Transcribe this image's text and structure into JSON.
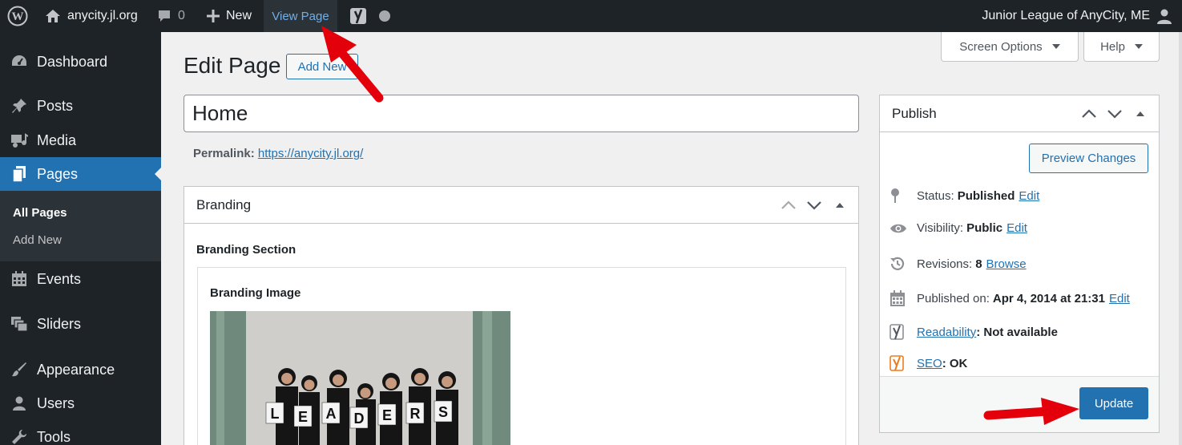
{
  "adminbar": {
    "site_name": "anycity.jl.org",
    "comments_count": "0",
    "new_label": "New",
    "view_page_label": "View Page",
    "account_name": "Junior League of AnyCity, ME"
  },
  "sidebar": {
    "items": [
      {
        "label": "Dashboard",
        "icon": "dashboard-icon"
      },
      {
        "label": "Posts",
        "icon": "pin-icon"
      },
      {
        "label": "Media",
        "icon": "media-icon"
      },
      {
        "label": "Pages",
        "icon": "pages-icon"
      },
      {
        "label": "Events",
        "icon": "calendar-icon"
      },
      {
        "label": "Sliders",
        "icon": "sliders-icon"
      },
      {
        "label": "Appearance",
        "icon": "brush-icon"
      },
      {
        "label": "Users",
        "icon": "users-icon"
      },
      {
        "label": "Tools",
        "icon": "wrench-icon"
      }
    ],
    "submenu": [
      "All Pages",
      "Add New"
    ]
  },
  "header": {
    "title": "Edit Page",
    "add_new_label": "Add New",
    "screen_options_label": "Screen Options",
    "help_label": "Help"
  },
  "editor": {
    "title_value": "Home",
    "permalink_label": "Permalink:",
    "permalink_url": "https://anycity.jl.org/"
  },
  "branding": {
    "box_title": "Branding",
    "section_label": "Branding Section",
    "image_label": "Branding Image",
    "photo_letters": [
      "L",
      "E",
      "A",
      "D",
      "E",
      "R",
      "S"
    ]
  },
  "publish": {
    "title": "Publish",
    "preview_label": "Preview Changes",
    "status_label": "Status:",
    "status_value": "Published",
    "visibility_label": "Visibility:",
    "visibility_value": "Public",
    "revisions_label": "Revisions:",
    "revisions_value": "8",
    "browse_label": "Browse",
    "published_label": "Published on:",
    "published_value": "Apr 4, 2014 at 21:31",
    "edit_label": "Edit",
    "readability_label": "Readability",
    "readability_value": ": Not available",
    "seo_label": "SEO",
    "seo_value": ": OK",
    "update_label": "Update"
  },
  "colors": {
    "admin_dark": "#1d2327",
    "accent": "#2271b1",
    "annotation_arrow": "#e3000b",
    "yoast_orange": "#ee7c1b"
  }
}
